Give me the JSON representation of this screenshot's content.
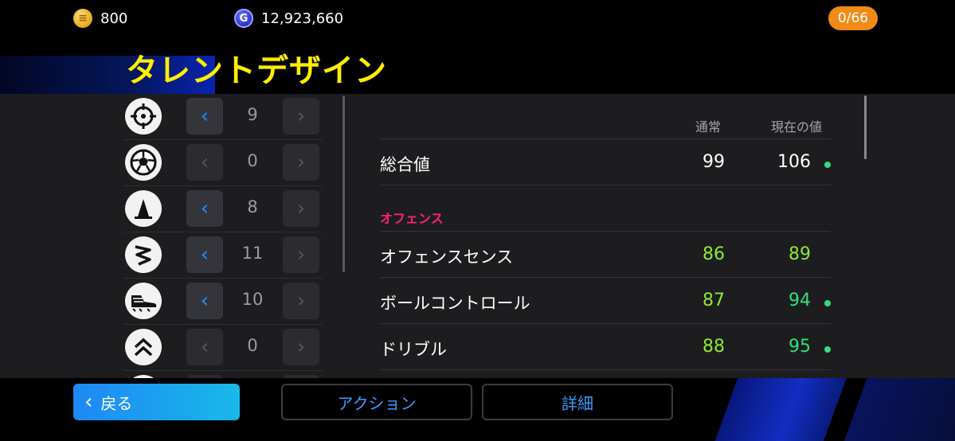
{
  "currency": {
    "coins": "800",
    "gp": "12,923,660",
    "counter": "0/66",
    "coin_icon": "coin-icon",
    "gp_icon": "gp-icon"
  },
  "title": "タレントデザイン",
  "talents": [
    {
      "icon": "target-icon",
      "value": "9",
      "left_active": true
    },
    {
      "icon": "ball-icon",
      "value": "0",
      "left_active": false
    },
    {
      "icon": "cone-icon",
      "value": "8",
      "left_active": true
    },
    {
      "icon": "zigzag-icon",
      "value": "11",
      "left_active": true
    },
    {
      "icon": "boot-icon",
      "value": "10",
      "left_active": true
    },
    {
      "icon": "chevrons-up-icon",
      "value": "0",
      "left_active": false
    }
  ],
  "stats": {
    "col_normal": "通常",
    "col_current": "現在の値",
    "overall": {
      "name": "総合値",
      "normal": "99",
      "current": "106",
      "boosted": true
    },
    "section": "オフェンス",
    "rows": [
      {
        "name": "オフェンスセンス",
        "normal": "86",
        "current": "89",
        "boosted": false
      },
      {
        "name": "ボールコントロール",
        "normal": "87",
        "current": "94",
        "boosted": true
      },
      {
        "name": "ドリブル",
        "normal": "88",
        "current": "95",
        "boosted": true
      }
    ]
  },
  "buttons": {
    "back": "戻る",
    "action": "アクション",
    "detail": "詳細"
  },
  "colors": {
    "title": "#ffee00",
    "accent_blue": "#1e8cff",
    "section_pink": "#ff1f7a",
    "normal_green": "#8ee832",
    "current_green": "#2fe07a",
    "dot_green": "#2fe07a",
    "counter_orange": "#f28a17"
  }
}
